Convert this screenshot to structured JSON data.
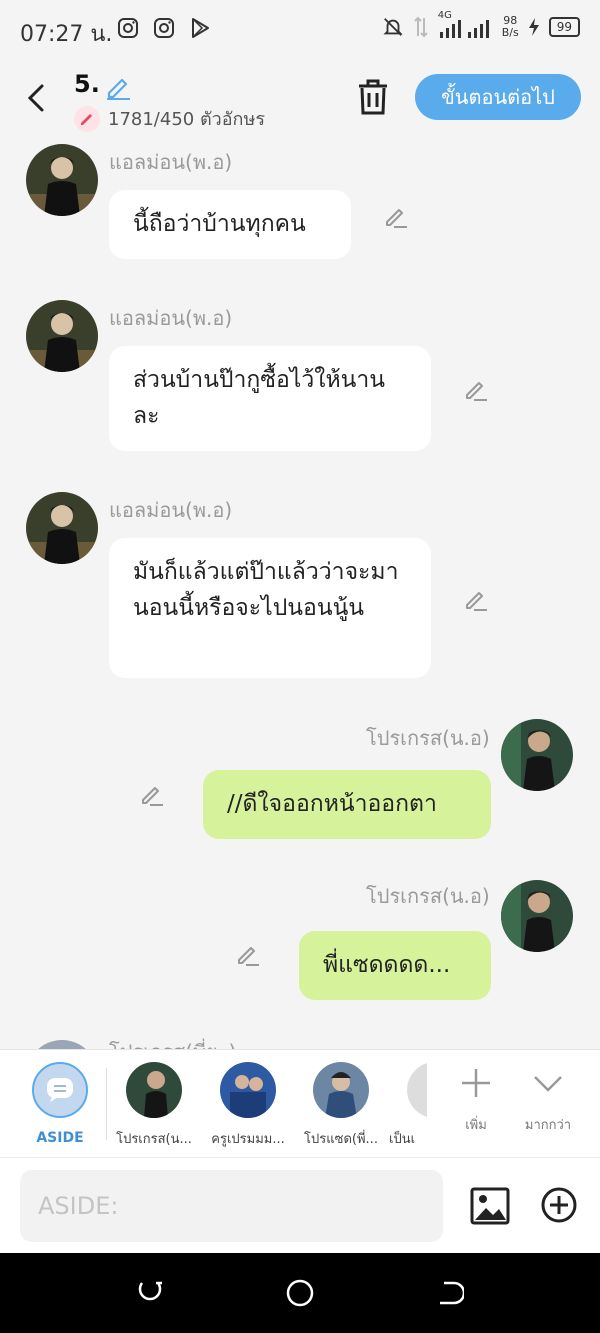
{
  "status_bar": {
    "time": "07:27 น.",
    "net_speed_top": "98",
    "net_speed_bottom": "B/s",
    "battery": "99",
    "network": "4G"
  },
  "header": {
    "title": "5.",
    "counter": "1781/450 ตัวอักษร",
    "next_label": "ขั้นตอนต่อไป"
  },
  "messages": [
    {
      "sender": "แอลม่อน(พ.อ)",
      "text": "นี้ถือว่าบ้านทุกคน",
      "side": "left"
    },
    {
      "sender": "แอลม่อน(พ.อ)",
      "text": "ส่วนบ้านป๊ากูซื้อไว้ให้นานละ",
      "side": "left"
    },
    {
      "sender": "แอลม่อน(พ.อ)",
      "text": "มันก็แล้วแต่ป๊าแล้วว่าจะมานอนนี้หรือจะไปนอนนู้น",
      "side": "left"
    },
    {
      "sender": "โปรเกรส(น.อ)",
      "text": "//ดีใจออกหน้าออกตา",
      "side": "right"
    },
    {
      "sender": "โปรเกรส(น.อ)",
      "text": "พี่แซดดดด...",
      "side": "right"
    }
  ],
  "partial_sender": "โปรเกรส(พี่ยะ)",
  "characters": {
    "aside_label": "ASIDE",
    "items": [
      {
        "name": "โปรเกรส(น..."
      },
      {
        "name": "ครูเปรมมม..."
      },
      {
        "name": "โปรแซด(พี่..."
      },
      {
        "name": "เป็นเ"
      }
    ],
    "add_label": "เพิ่ม",
    "more_label": "มากกว่า"
  },
  "input": {
    "placeholder": "ASIDE:"
  },
  "colors": {
    "accent": "#5aabec",
    "right_bubble": "#d6f39b",
    "left_bubble": "#ffffff",
    "background": "#f4f4f4"
  }
}
